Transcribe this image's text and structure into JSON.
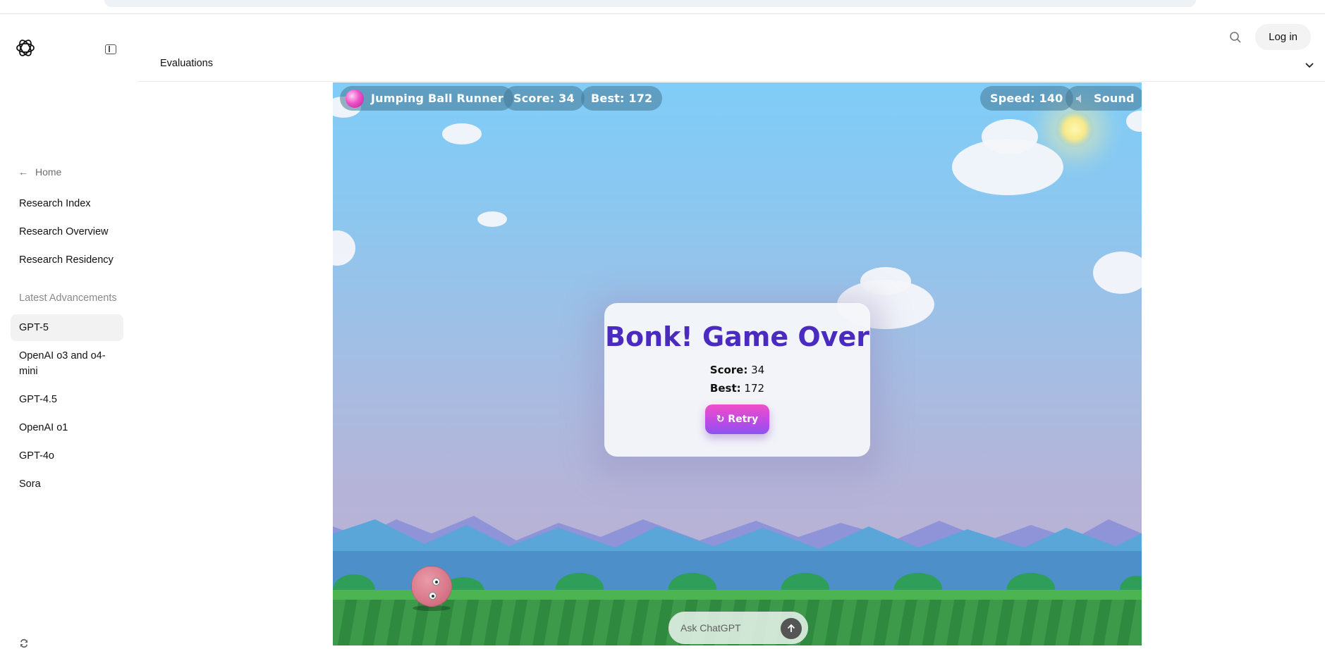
{
  "header": {
    "login_label": "Log in",
    "icons": [
      "openai-logo-icon",
      "sidebar-toggle-icon",
      "search-icon"
    ]
  },
  "sidebar": {
    "home_label": "Home",
    "items": [
      {
        "label": "Research Index"
      },
      {
        "label": "Research Overview"
      },
      {
        "label": "Research Residency"
      }
    ],
    "section_heading": "Latest Advancements",
    "advancements": [
      {
        "label": "GPT-5",
        "active": true
      },
      {
        "label": "OpenAI o3 and o4-mini",
        "active": false
      },
      {
        "label": "GPT-4.5",
        "active": false
      },
      {
        "label": "OpenAI o1",
        "active": false
      },
      {
        "label": "GPT-4o",
        "active": false
      },
      {
        "label": "Sora",
        "active": false
      }
    ]
  },
  "evaluations": {
    "label": "Evaluations"
  },
  "game": {
    "title": "Jumping Ball Runner",
    "score_label": "Score: 34",
    "best_label": "Best: 172",
    "speed_label": "Speed: 140",
    "sound_label": "Sound",
    "game_over": {
      "title": "Bonk! Game Over",
      "score_key": "Score:",
      "score_value": "34",
      "best_key": "Best:",
      "best_value": "172",
      "retry_label": "↻ Retry"
    },
    "colors": {
      "title": "#4b2bbf",
      "retry_start": "#f04fc8",
      "retry_end": "#8d52f0",
      "sky_top": "#7fcdf8",
      "grass": "#3d9a4b"
    }
  },
  "chat": {
    "placeholder": "Ask ChatGPT"
  }
}
